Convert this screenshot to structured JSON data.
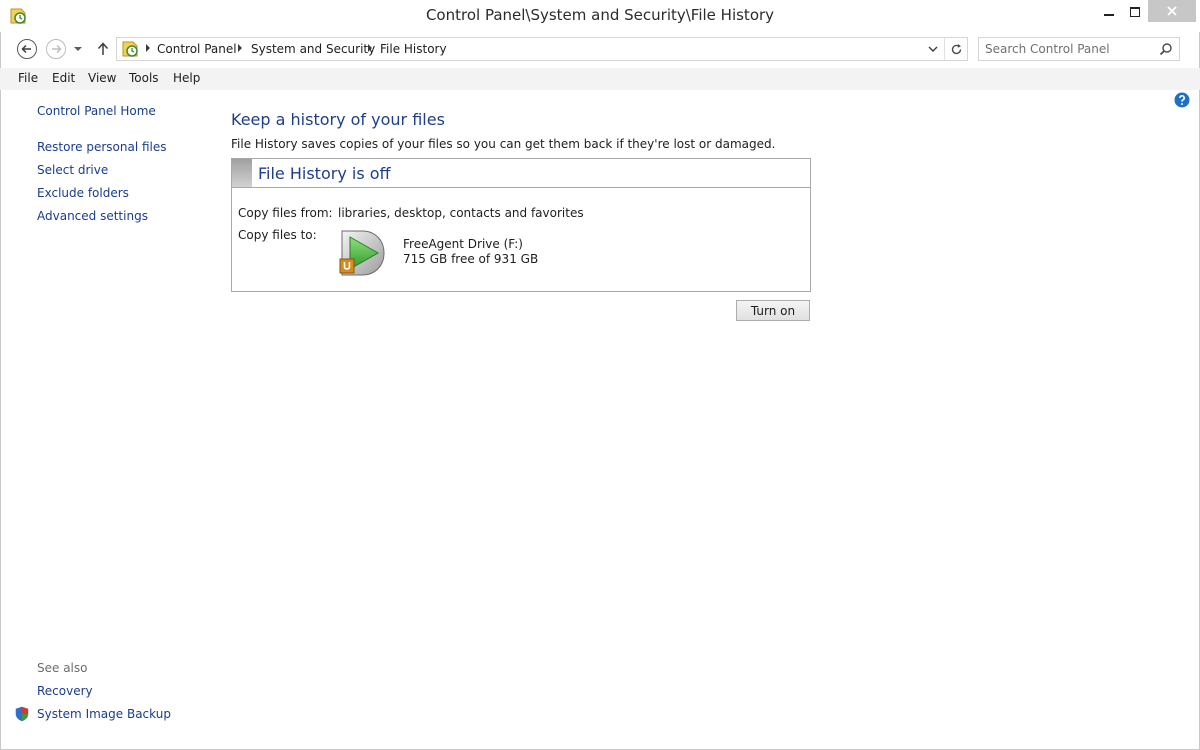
{
  "window": {
    "title": "Control Panel\\System and Security\\File History"
  },
  "address_bar": {
    "crumbs": [
      "Control Panel",
      "System and Security",
      "File History"
    ]
  },
  "search": {
    "placeholder": "Search Control Panel"
  },
  "menu": {
    "items": [
      "File",
      "Edit",
      "View",
      "Tools",
      "Help"
    ]
  },
  "sidebar": {
    "home": "Control Panel Home",
    "links": [
      "Restore personal files",
      "Select drive",
      "Exclude folders",
      "Advanced settings"
    ],
    "see_also_label": "See also",
    "see_also": [
      "Recovery",
      "System Image Backup"
    ]
  },
  "main": {
    "title": "Keep a history of your files",
    "description": "File History saves copies of your files so you can get them back if they're lost or damaged.",
    "status": {
      "title": "File History is off",
      "copy_from_label": "Copy files from:",
      "copy_from_value": "libraries, desktop, contacts and favorites",
      "copy_to_label": "Copy files to:",
      "drive_name": "FreeAgent Drive (F:)",
      "drive_space": "715 GB free of 931 GB"
    },
    "turn_on_label": "Turn on"
  },
  "colors": {
    "link": "#1a3d8f",
    "heading": "#1e3e8b",
    "menubar": "#f3f3f3"
  },
  "icons": {
    "app": "file-history-icon",
    "drive": "external-drive-play-icon",
    "help": "help-icon",
    "shield": "uac-shield-icon"
  }
}
